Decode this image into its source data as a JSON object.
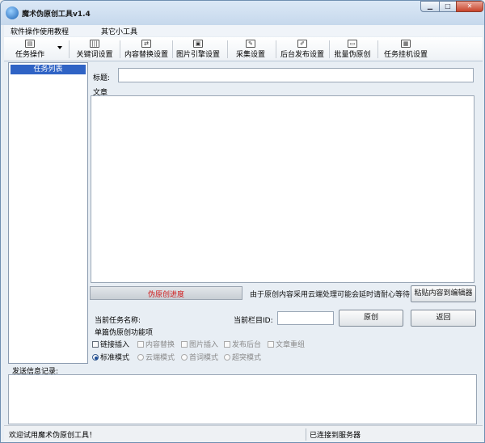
{
  "window": {
    "title": "魔术伪原创工具v1.4",
    "controls": [
      "minimize",
      "maximize",
      "close"
    ]
  },
  "menu": {
    "items": [
      {
        "label": "软件操作使用教程"
      },
      {
        "label": "其它小工具"
      }
    ]
  },
  "toolbar": {
    "buttons": [
      {
        "label": "任务操作",
        "icon": "task-icon",
        "has_dropdown": true
      },
      {
        "label": "关键词设置",
        "icon": "keyword-icon"
      },
      {
        "label": "内容替换设置",
        "icon": "replace-icon"
      },
      {
        "label": "图片引擎设置",
        "icon": "image-icon"
      },
      {
        "label": "采集设置",
        "icon": "collect-icon"
      },
      {
        "label": "后台发布设置",
        "icon": "publish-icon"
      },
      {
        "label": "批量伪原创",
        "icon": "folder-icon"
      },
      {
        "label": "任务挂机设置",
        "icon": "hangup-icon"
      }
    ]
  },
  "left_panel": {
    "header": "任务列表"
  },
  "form": {
    "title_label": "标题:",
    "title_value": "",
    "article_label": "文章",
    "article_value": "",
    "progress_label": "伪原创进度",
    "progress_fraction": 0,
    "notice": "由于原创内容采用云端处理可能会延时请耐心等待",
    "paste_button": "粘贴内容到编辑器",
    "current_task_label": "当前任务名称:",
    "current_task_value": "",
    "current_column_label": "当前栏目ID:",
    "current_column_value": "",
    "original_button": "原创",
    "return_button": "返回"
  },
  "options": {
    "title": "单篇伪原创功能项",
    "checkboxes": [
      {
        "label": "链接插入",
        "enabled": true,
        "checked": false
      },
      {
        "label": "内容替换",
        "enabled": false,
        "checked": false
      },
      {
        "label": "图片插入",
        "enabled": false,
        "checked": false
      },
      {
        "label": "发布后台",
        "enabled": false,
        "checked": false
      },
      {
        "label": "文章重组",
        "enabled": false,
        "checked": false
      }
    ],
    "radios": [
      {
        "label": "标准模式",
        "selected": true,
        "enabled": true
      },
      {
        "label": "云端模式",
        "selected": false,
        "enabled": false
      },
      {
        "label": "首词模式",
        "selected": false,
        "enabled": false
      },
      {
        "label": "超突模式",
        "selected": false,
        "enabled": false
      }
    ]
  },
  "log": {
    "label": "发送信息记录:",
    "content": ""
  },
  "status": {
    "left": "欢迎试用魔术伪原创工具！",
    "right": "已连接到服务器"
  },
  "colors": {
    "task_list_header": "#2f63c5",
    "progress_text": "#d01818",
    "close_button": "#c8442b"
  }
}
